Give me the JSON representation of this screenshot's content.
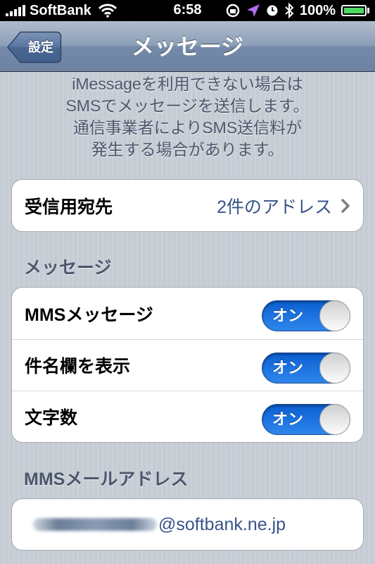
{
  "status_bar": {
    "carrier": "SoftBank",
    "time": "6:58",
    "battery_percent": "100%",
    "icons": [
      "signal-bars-icon",
      "wifi-icon",
      "rotation-lock-icon",
      "location-arrow-icon",
      "alarm-clock-icon",
      "bluetooth-icon",
      "battery-icon"
    ]
  },
  "nav": {
    "back_label": "設定",
    "title": "メッセージ"
  },
  "info_lines": [
    "iMessageを利用できない場合は",
    "SMSでメッセージを送信します。",
    "通信事業者によりSMS送信料が",
    "発生する場合があります。"
  ],
  "receive": {
    "label": "受信用宛先",
    "value": "2件のアドレス"
  },
  "messages_section": {
    "header": "メッセージ",
    "rows": [
      {
        "label": "MMSメッセージ",
        "toggle": "オン"
      },
      {
        "label": "件名欄を表示",
        "toggle": "オン"
      },
      {
        "label": "文字数",
        "toggle": "オン"
      }
    ]
  },
  "mms_email": {
    "header": "MMSメールアドレス",
    "domain": "@softbank.ne.jp"
  },
  "colors": {
    "toggle_on": "#1b6fe0",
    "value_text": "#385487",
    "section_text": "#4c566c"
  }
}
